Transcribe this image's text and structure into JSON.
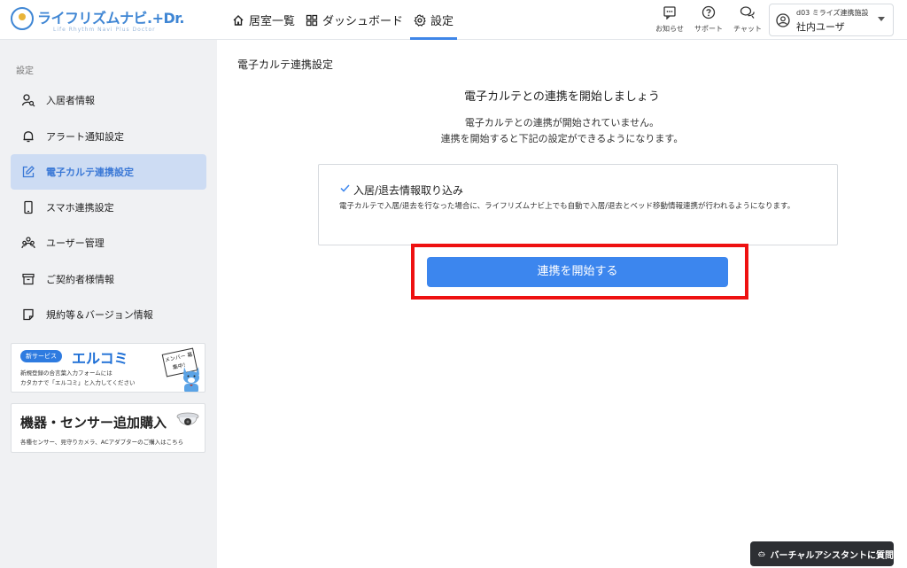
{
  "app": {
    "logo_text": "ライフリズムナビ.+Dr.",
    "logo_sub": "Life Rhythm Navi  Plus Doctor"
  },
  "nav": {
    "rooms": "居室一覧",
    "dashboard": "ダッシュボード",
    "settings": "設定"
  },
  "header": {
    "notice": "お知らせ",
    "support": "サポート",
    "chat": "チャット",
    "facility": "d03 ミライズ連携施設",
    "user": "社内ユーザ"
  },
  "sidebar": {
    "heading": "設定",
    "items": [
      {
        "label": "入居者情報",
        "icon": "resident-icon"
      },
      {
        "label": "アラート通知設定",
        "icon": "bell-icon"
      },
      {
        "label": "電子カルテ連携設定",
        "icon": "edit-icon"
      },
      {
        "label": "スマホ連携設定",
        "icon": "smartphone-icon"
      },
      {
        "label": "ユーザー管理",
        "icon": "users-icon"
      },
      {
        "label": "ご契約者様情報",
        "icon": "archive-icon"
      },
      {
        "label": "規約等＆バージョン情報",
        "icon": "document-icon"
      }
    ],
    "active_index": 2
  },
  "banner1": {
    "badge": "新サービス",
    "title": "エルコミ",
    "line1": "新規登録の合言葉入力フォームには",
    "line2": "カタカナで「エルコミ」と入力してください",
    "sign": "メンバー 募集中！"
  },
  "banner2": {
    "title": "機器・センサー追加購入",
    "sub": "各種センサー、見守りカメラ、ACアダプターのご購入はこちら"
  },
  "main": {
    "page_title": "電子カルテ連携設定",
    "heading": "電子カルテとの連携を開始しましょう",
    "desc1": "電子カルテとの連携が開始されていません。",
    "desc2": "連携を開始すると下記の設定ができるようになります。",
    "card_title": "入居/退去情報取り込み",
    "card_desc": "電子カルテで入居/退去を行なった場合に、ライフリズムナビ上でも自動で入居/退去とベッド移動情報連携が行われるようになります。",
    "start_button": "連携を開始する"
  },
  "assistant": {
    "label": "バーチャルアシスタントに質問"
  },
  "colors": {
    "accent": "#3c86ee",
    "highlight": "#ee1111",
    "sidebar_active": "#cddcf3"
  }
}
